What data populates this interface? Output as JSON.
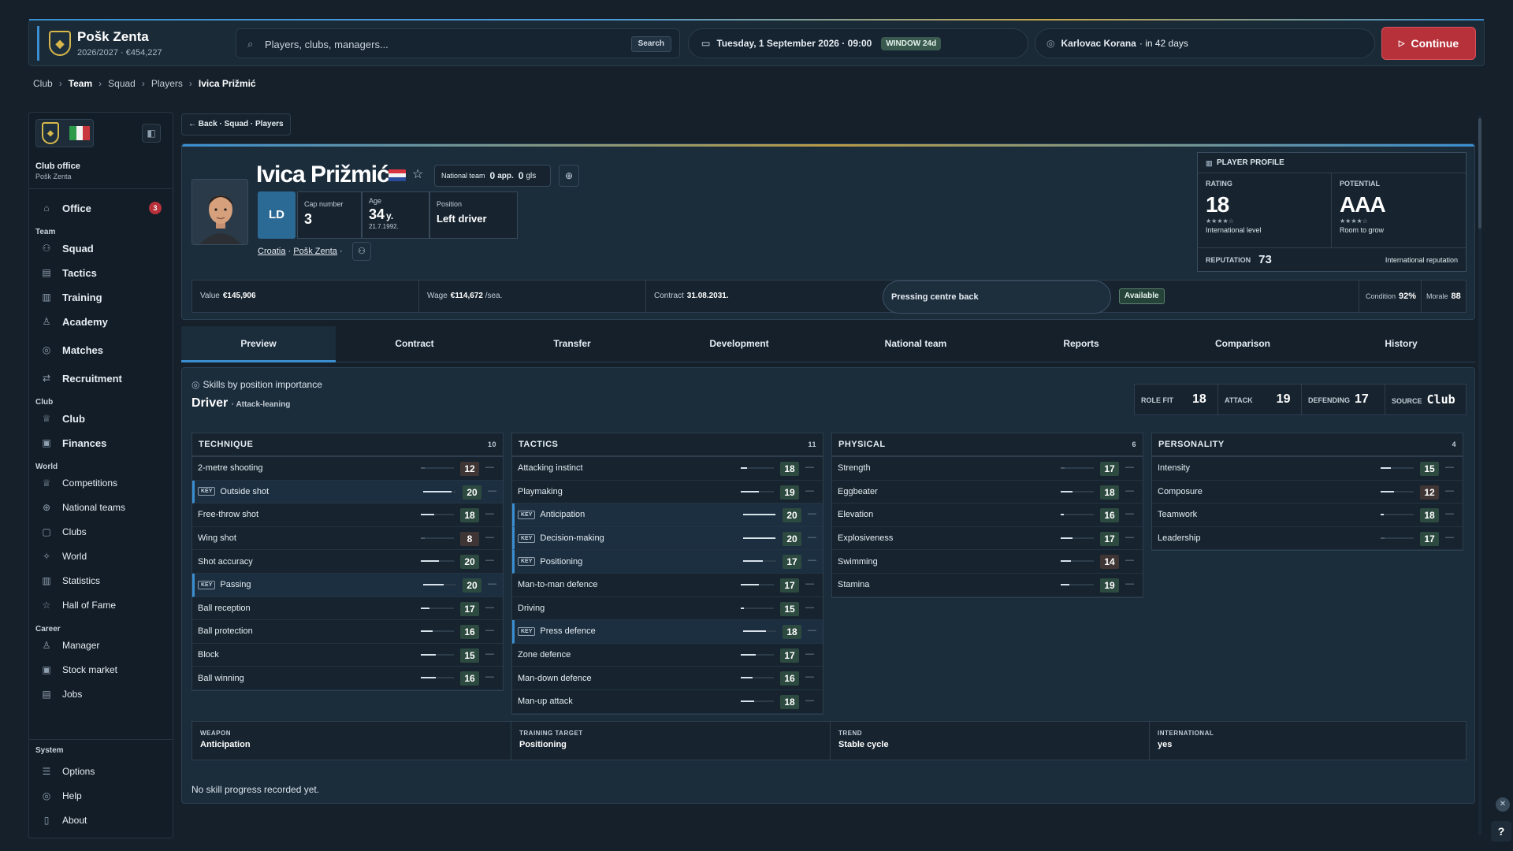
{
  "topbar": {
    "club_name": "Pošk Zenta",
    "club_sub": "2026/2027 · €454,227",
    "search_placeholder": "Players, clubs, managers...",
    "search_button": "Search",
    "date": "Tuesday, 1 September 2026 · 09:00",
    "window_badge": "WINDOW 24d",
    "next_opponent": "Karlovac Korana",
    "next_when": "· in 42 days",
    "continue_label": "Continue"
  },
  "breadcrumb": [
    "Club",
    "Team",
    "Squad",
    "Players",
    "Ivica Prižmić"
  ],
  "sidebar": {
    "office_title": "Club office",
    "office_sub": "Pošk Zenta",
    "office": "Office",
    "office_badge": "3",
    "team_head": "Team",
    "team_items": [
      "Squad",
      "Tactics",
      "Training",
      "Academy"
    ],
    "matches": "Matches",
    "recruitment": "Recruitment",
    "club_head": "Club",
    "club_items": [
      "Club",
      "Finances"
    ],
    "world_head": "World",
    "world_items": [
      "Competitions",
      "National teams",
      "Clubs",
      "World",
      "Statistics",
      "Hall of Fame"
    ],
    "career_head": "Career",
    "career_items": [
      "Manager",
      "Stock market",
      "Jobs"
    ],
    "system_head": "System",
    "system_items": [
      "Options",
      "Help",
      "About"
    ]
  },
  "back_label": "← Back · Squad · Players",
  "player": {
    "name": "Ivica Prižmić",
    "national_team_label": "National team",
    "apps": "0",
    "apps_unit": "app.",
    "goals": "0",
    "goals_unit": "gls",
    "position_code": "LD",
    "cap_label": "Cap number",
    "cap": "3",
    "age_label": "Age",
    "age": "34",
    "age_unit": "y.",
    "dob": "21.7.1992.",
    "position_label": "Position",
    "position": "Left driver",
    "country": "Croatia",
    "club": "Pošk Zenta",
    "sep": "·"
  },
  "profile": {
    "header": "PLAYER PROFILE",
    "rating_label": "RATING",
    "rating": "18",
    "rating_stars": "★★★★☆",
    "rating_caption": "International level",
    "potential_label": "POTENTIAL",
    "potential": "AAA",
    "potential_stars": "★★★★☆",
    "potential_caption": "Room to grow",
    "reputation_label": "REPUTATION",
    "reputation": "73",
    "reputation_caption": "International reputation"
  },
  "values": {
    "value_label": "Value",
    "value": "€145,906",
    "wage_label": "Wage",
    "wage": "€114,672",
    "wage_unit": "/sea.",
    "contract_label": "Contract",
    "contract": "31.08.2031.",
    "style": "Pressing centre back",
    "availability": "Available",
    "condition_label": "Condition",
    "condition": "92%",
    "morale_label": "Morale",
    "morale": "88"
  },
  "tabs": [
    "Preview",
    "Contract",
    "Transfer",
    "Development",
    "National team",
    "Reports",
    "Comparison",
    "History"
  ],
  "skills": {
    "title": "Skills by position importance",
    "role": "Driver",
    "role_sub": "· Attack-leaning",
    "role_fit_label": "ROLE FIT",
    "role_fit": "18",
    "attack_label": "ATTACK",
    "attack": "19",
    "defending_label": "DEFENDING",
    "defending": "17",
    "source_label": "SOURCE",
    "source": "Club",
    "key_tag": "KEY",
    "groups": [
      {
        "name": "TECHNIQUE",
        "count": "10",
        "rows": [
          {
            "label": "2-metre shooting",
            "value": "12",
            "key": false,
            "fill": 0.0
          },
          {
            "label": "Outside shot",
            "value": "20",
            "key": true,
            "fill": 0.85
          },
          {
            "label": "Free-throw shot",
            "value": "18",
            "key": false,
            "fill": 0.4
          },
          {
            "label": "Wing shot",
            "value": "8",
            "key": false,
            "fill": 0.0
          },
          {
            "label": "Shot accuracy",
            "value": "20",
            "key": false,
            "fill": 0.55
          },
          {
            "label": "Passing",
            "value": "20",
            "key": true,
            "fill": 0.62
          },
          {
            "label": "Ball reception",
            "value": "17",
            "key": false,
            "fill": 0.25
          },
          {
            "label": "Ball protection",
            "value": "16",
            "key": false,
            "fill": 0.35
          },
          {
            "label": "Block",
            "value": "15",
            "key": false,
            "fill": 0.45
          },
          {
            "label": "Ball winning",
            "value": "16",
            "key": false,
            "fill": 0.45
          }
        ]
      },
      {
        "name": "TACTICS",
        "count": "11",
        "rows": [
          {
            "label": "Attacking instinct",
            "value": "18",
            "key": false,
            "fill": 0.2
          },
          {
            "label": "Playmaking",
            "value": "19",
            "key": false,
            "fill": 0.55
          },
          {
            "label": "Anticipation",
            "value": "20",
            "key": true,
            "fill": 0.98
          },
          {
            "label": "Decision-making",
            "value": "20",
            "key": true,
            "fill": 0.98
          },
          {
            "label": "Positioning",
            "value": "17",
            "key": true,
            "fill": 0.6
          },
          {
            "label": "Man-to-man defence",
            "value": "17",
            "key": false,
            "fill": 0.55
          },
          {
            "label": "Driving",
            "value": "15",
            "key": false,
            "fill": 0.1
          },
          {
            "label": "Press defence",
            "value": "18",
            "key": true,
            "fill": 0.7
          },
          {
            "label": "Zone defence",
            "value": "17",
            "key": false,
            "fill": 0.45
          },
          {
            "label": "Man-down defence",
            "value": "16",
            "key": false,
            "fill": 0.35
          },
          {
            "label": "Man-up attack",
            "value": "18",
            "key": false,
            "fill": 0.4
          }
        ]
      },
      {
        "name": "PHYSICAL",
        "count": "6",
        "rows": [
          {
            "label": "Strength",
            "value": "17",
            "key": false,
            "fill": 0.0
          },
          {
            "label": "Eggbeater",
            "value": "18",
            "key": false,
            "fill": 0.35
          },
          {
            "label": "Elevation",
            "value": "16",
            "key": false,
            "fill": 0.1
          },
          {
            "label": "Explosiveness",
            "value": "17",
            "key": false,
            "fill": 0.35
          },
          {
            "label": "Swimming",
            "value": "14",
            "key": false,
            "fill": 0.3
          },
          {
            "label": "Stamina",
            "value": "19",
            "key": false,
            "fill": 0.25
          }
        ]
      },
      {
        "name": "PERSONALITY",
        "count": "4",
        "rows": [
          {
            "label": "Intensity",
            "value": "15",
            "key": false,
            "fill": 0.3
          },
          {
            "label": "Composure",
            "value": "12",
            "key": false,
            "fill": 0.4
          },
          {
            "label": "Teamwork",
            "value": "18",
            "key": false,
            "fill": 0.1
          },
          {
            "label": "Leadership",
            "value": "17",
            "key": false,
            "fill": 0.0
          }
        ]
      }
    ],
    "weapon_label": "WEAPON",
    "weapon": "Anticipation",
    "training_label": "TRAINING TARGET",
    "training": "Positioning",
    "trend_label": "TREND",
    "trend": "Stable cycle",
    "intl_label": "INTERNATIONAL",
    "intl": "yes",
    "no_progress": "No skill progress recorded yet."
  },
  "colors": {
    "accent": "#3b8fd0",
    "danger": "#b7313b",
    "gold": "#d7b84b",
    "bg": "#15202b"
  }
}
